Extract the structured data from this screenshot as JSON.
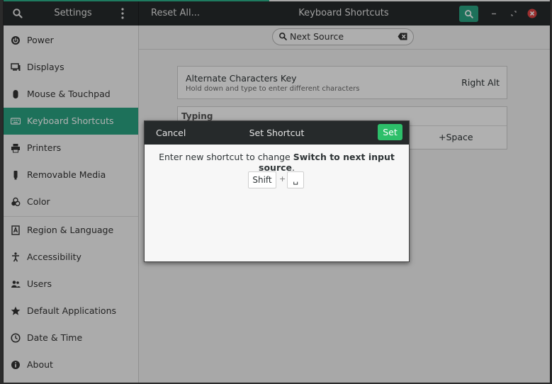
{
  "headerbar": {
    "settings_title": "Settings",
    "reset_label": "Reset All...",
    "panel_title": "Keyboard Shortcuts"
  },
  "sidebar": {
    "items": [
      {
        "label": "Power",
        "icon": "power-icon"
      },
      {
        "label": "Displays",
        "icon": "display-icon"
      },
      {
        "label": "Mouse & Touchpad",
        "icon": "mouse-icon"
      },
      {
        "label": "Keyboard Shortcuts",
        "icon": "keyboard-icon",
        "active": true
      },
      {
        "label": "Printers",
        "icon": "printer-icon"
      },
      {
        "label": "Removable Media",
        "icon": "usb-drive-icon"
      },
      {
        "label": "Color",
        "icon": "color-icon"
      },
      {
        "label": "Region & Language",
        "icon": "region-language-icon"
      },
      {
        "label": "Accessibility",
        "icon": "accessibility-icon"
      },
      {
        "label": "Users",
        "icon": "users-icon"
      },
      {
        "label": "Default Applications",
        "icon": "star-icon"
      },
      {
        "label": "Date & Time",
        "icon": "clock-icon"
      },
      {
        "label": "About",
        "icon": "info-icon"
      }
    ]
  },
  "search": {
    "value": "Next Source"
  },
  "shortcuts": {
    "alt_chars": {
      "name": "Alternate Characters Key",
      "description": "Hold down and type to enter different characters",
      "accel": "Right Alt"
    },
    "typing": {
      "section": "Typing",
      "accel_partial": "+Space"
    }
  },
  "dialog": {
    "cancel_label": "Cancel",
    "title": "Set Shortcut",
    "set_label": "Set",
    "message_prefix": "Enter new shortcut to change ",
    "message_action": "Switch to next input source",
    "message_suffix": ".",
    "keys": [
      "Shift",
      "+",
      "␣"
    ]
  },
  "colors": {
    "accent": "#2aa382",
    "set_button": "#2dbf6a",
    "close_button": "#e04444",
    "headerbar": "#262a2b"
  }
}
